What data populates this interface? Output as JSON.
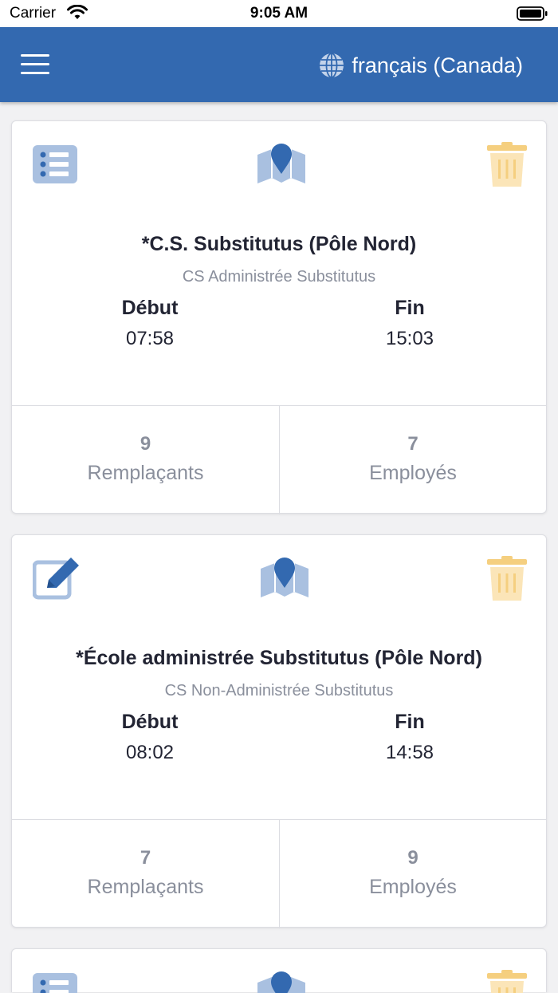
{
  "status_bar": {
    "carrier": "Carrier",
    "time": "9:05 AM"
  },
  "header": {
    "language": "français (Canada)"
  },
  "labels": {
    "start": "Début",
    "end": "Fin",
    "substitutes": "Remplaçants",
    "employees": "Employés"
  },
  "colors": {
    "primary": "#3369b0",
    "icon_light": "#a9c0e0",
    "trash": "#f5cf7f",
    "muted_text": "#8a8f9c"
  },
  "cards": [
    {
      "left_icon": "list-icon",
      "title": "*C.S. Substitutus (Pôle Nord)",
      "subtitle": "CS Administrée Substitutus",
      "start_time": "07:58",
      "end_time": "15:03",
      "substitutes_count": "9",
      "employees_count": "7"
    },
    {
      "left_icon": "edit-icon",
      "title": "*École administrée Substitutus (Pôle Nord)",
      "subtitle": "CS Non-Administrée Substitutus",
      "start_time": "08:02",
      "end_time": "14:58",
      "substitutes_count": "7",
      "employees_count": "9"
    },
    {
      "left_icon": "list-icon"
    }
  ]
}
